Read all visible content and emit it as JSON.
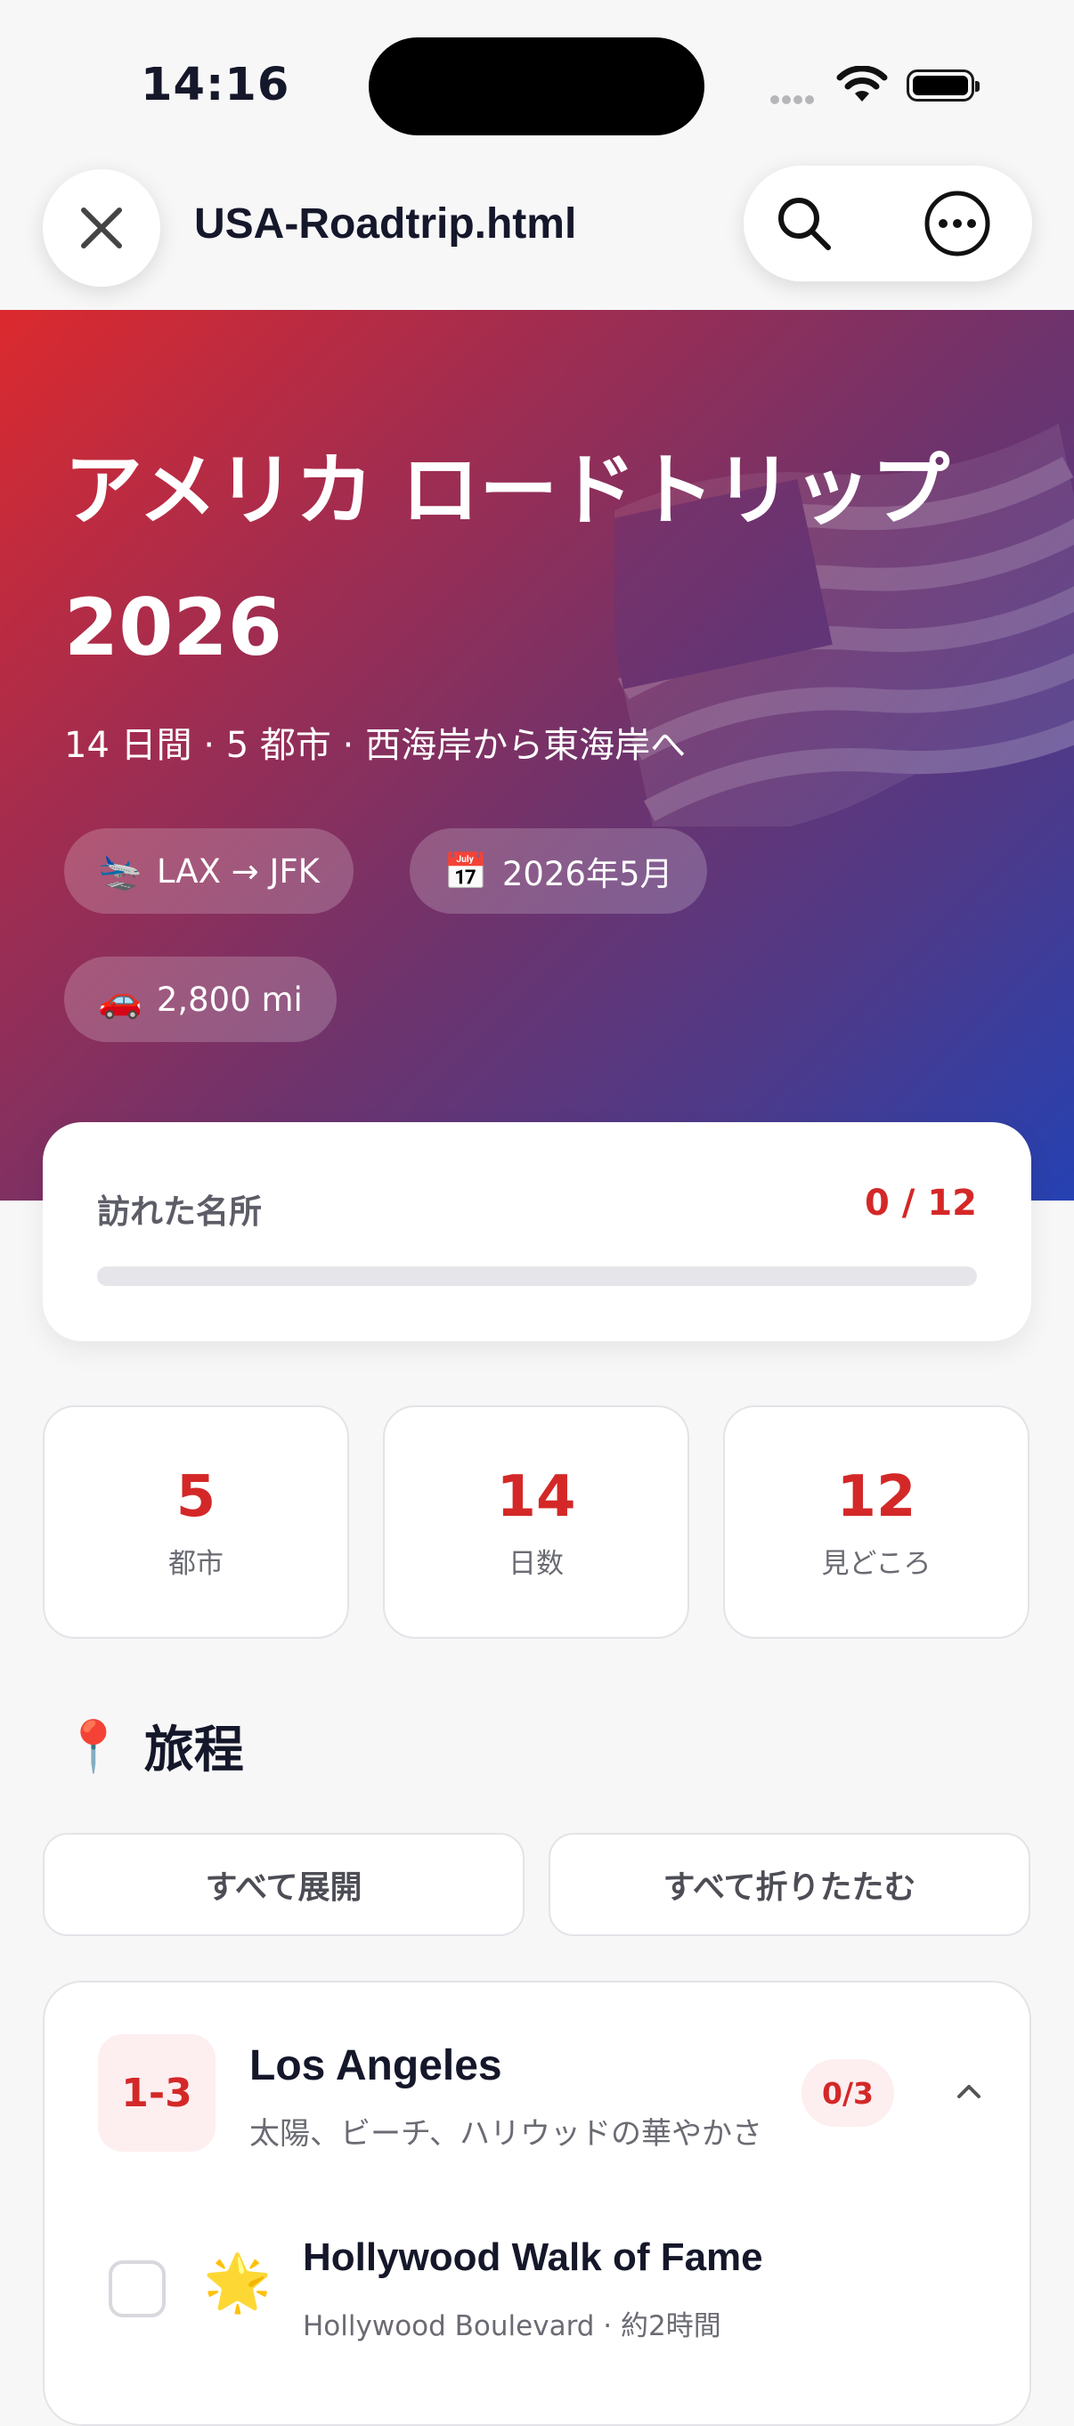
{
  "status_bar": {
    "time": "14:16"
  },
  "top_bar": {
    "title": "USA-Roadtrip.html"
  },
  "hero": {
    "title": "アメリカ ロードトリップ 2026",
    "subtitle": "14 日間 · 5 都市 · 西海岸から東海岸へ",
    "chips": [
      {
        "emoji": "🛬",
        "label": "LAX → JFK"
      },
      {
        "emoji": "📅",
        "label": "2026年5月"
      },
      {
        "emoji": "🚗",
        "label": "2,800 mi"
      }
    ]
  },
  "progress": {
    "label": "訪れた名所",
    "count_text": "0 / 12",
    "fraction": 0
  },
  "stats": [
    {
      "value": "5",
      "label": "都市"
    },
    {
      "value": "14",
      "label": "日数"
    },
    {
      "value": "12",
      "label": "見どころ"
    }
  ],
  "itinerary": {
    "icon": "📍",
    "title": "旅程",
    "expand_all": "すべて展開",
    "collapse_all": "すべて折りたたむ"
  },
  "cities": [
    {
      "days": "1-3",
      "name": "Los Angeles",
      "desc": "太陽、ビーチ、ハリウッドの華やかさ",
      "count": "0/3",
      "spots": [
        {
          "icon": "🌟",
          "name": "Hollywood Walk of Fame",
          "meta": "Hollywood Boulevard · 約2時間"
        }
      ]
    }
  ],
  "colors": {
    "accent": "#d42828",
    "hero_start": "#dc2a2e",
    "hero_end": "#2541b2"
  }
}
